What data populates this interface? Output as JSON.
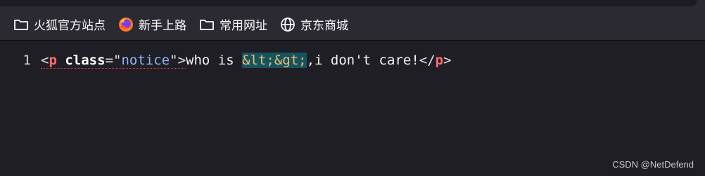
{
  "bookmarks": [
    {
      "label": "火狐官方站点",
      "icon": "folder-icon"
    },
    {
      "label": "新手上路",
      "icon": "firefox-icon"
    },
    {
      "label": "常用网址",
      "icon": "folder-icon"
    },
    {
      "label": "京东商城",
      "icon": "globe-icon"
    }
  ],
  "source": {
    "line_number": "1",
    "open_lt": "<",
    "tag": "p",
    "attr_name": "class",
    "equals": "=",
    "quote_open": "\"",
    "attr_value": "notice",
    "quote_close": "\"",
    "open_gt": ">",
    "text_before": "who is ",
    "entity": "&lt;&gt;",
    "text_after": ",i don't care!",
    "close_lt": "</",
    "close_tag": "p",
    "close_gt": ">"
  },
  "watermark": "CSDN @NetDefend",
  "colors": {
    "background": "#1f1e24",
    "toolbar": "#2b2a33",
    "tag": "#ff6b6b",
    "attr_value": "#8fb5ff",
    "entity_text": "#f4b870",
    "entity_highlight": "#14545e"
  }
}
